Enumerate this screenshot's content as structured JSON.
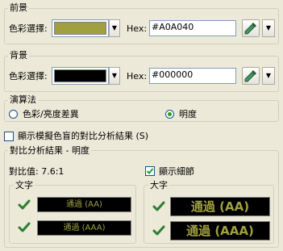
{
  "foreground": {
    "title": "前景",
    "picker_label": "色彩選擇:",
    "hex_label": "Hex:",
    "hex_value": "#A0A040",
    "swatch_color": "#A0A040",
    "dropdown_arrow_icon": "triangle-down",
    "eyedropper_icon": "eyedropper"
  },
  "background": {
    "title": "背景",
    "picker_label": "色彩選擇:",
    "hex_label": "Hex:",
    "hex_value": "#000000",
    "swatch_color": "#000000"
  },
  "algorithm": {
    "title": "演算法",
    "options": [
      "色彩/亮度差異",
      "明度"
    ],
    "selected_index": 1
  },
  "simulate_colorblind": {
    "label": "顯示模擬色盲的對比分析結果",
    "shortcut": "(S)",
    "checked": false
  },
  "results": {
    "title": "對比分析結果 - 明度",
    "ratio_label": "對比值: 7.6:1",
    "show_details_label": "顯示細節",
    "show_details_checked": true,
    "text_group": {
      "title": "文字",
      "samples": [
        "通過 (AA)",
        "通過 (AAA)"
      ]
    },
    "large_group": {
      "title": "大字",
      "samples": [
        "通過 (AA)",
        "通過 (AAA)"
      ]
    }
  },
  "colors": {
    "window_bg": "#ECE9D8",
    "group_border": "#D0D0BF",
    "pass_check": "#2E7D32",
    "sample_text": "#A0A040",
    "sample_bg": "#000000"
  }
}
